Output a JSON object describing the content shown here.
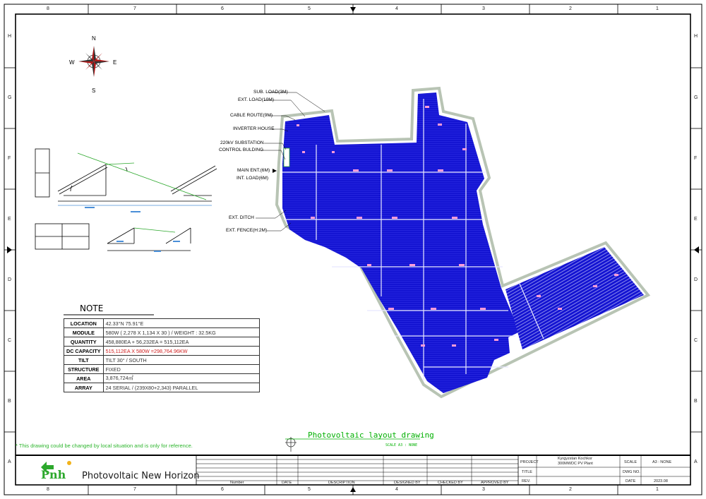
{
  "zones_top": [
    "8",
    "7",
    "6",
    "5",
    "4",
    "3",
    "2",
    "1"
  ],
  "zones_bottom": [
    "8",
    "7",
    "6",
    "5",
    "4",
    "3",
    "2",
    "1"
  ],
  "zones_left": [
    "H",
    "G",
    "F",
    "E",
    "D",
    "C",
    "B",
    "A"
  ],
  "zones_right": [
    "H",
    "G",
    "F",
    "E",
    "D",
    "C",
    "B",
    "A"
  ],
  "compass": {
    "n": "N",
    "s": "S",
    "e": "E",
    "w": "W"
  },
  "note": {
    "title": "NOTE",
    "rows": [
      {
        "key": "LOCATION",
        "value": "42.33°N 75.91°E"
      },
      {
        "key": "MODULE",
        "value": "580W ( 2,278 X 1,134 X 30 ) / WEIGHT : 32.5KG"
      },
      {
        "key": "QUANTITY",
        "value": "458,880EA + 56,232EA = 515,112EA"
      },
      {
        "key": "DC CAPACITY",
        "value": "515,112EA X 580W =298,764.96KW"
      },
      {
        "key": "TILT",
        "value": "TILT 30° / SOUTH"
      },
      {
        "key": "STRUCTURE",
        "value": "FIXED"
      },
      {
        "key": "AREA",
        "value": "3,876,724㎡"
      },
      {
        "key": "ARRAY",
        "value": "24 SERIAL /  (239X80+2,343) PARALLEL"
      }
    ]
  },
  "callouts": [
    "SUB. LOAD(3M)",
    "EXT. LOAD(10M)",
    "CABLE ROUTE(9M)",
    "INVERTER HOUSE",
    "220kV SUBSTATION",
    "CONTROL BULDING",
    "MAIN ENT.(6M)",
    "INT. LOAD(6M)",
    "EXT. DITCH",
    "EXT. FENCE(H:2M)"
  ],
  "drawing_title": "Photovoltaic layout drawing",
  "drawing_scale": "SCALE   A3 : NONE",
  "disclaimer": "* This drawing could be changed by local situation and is only for reference.",
  "title_block": {
    "brand": "Photovoltaic New Horizon",
    "logo_text": "Pnh",
    "revision_headers": [
      "Number",
      "DATE",
      "DESCRIPTION",
      "DESIGNED BY",
      "CHECKED BY",
      "APPROVED BY"
    ],
    "project_label": "PROJECT",
    "project_value_1": "Kyrgyzstan Kochkor",
    "project_value_2": "300MWDC PV Plant",
    "title_label": "TITLE",
    "rev_label": "REV.",
    "scale_label": "SCALE",
    "scale_value": "A3 : NONE",
    "dwg_label": "DWG NO.",
    "date_label": "DATE",
    "date_value": "2023.08"
  },
  "colors": {
    "panel": "#1414d2",
    "fence": "#b8c4b4",
    "accent_green": "#00b000",
    "red": "#d02020"
  }
}
